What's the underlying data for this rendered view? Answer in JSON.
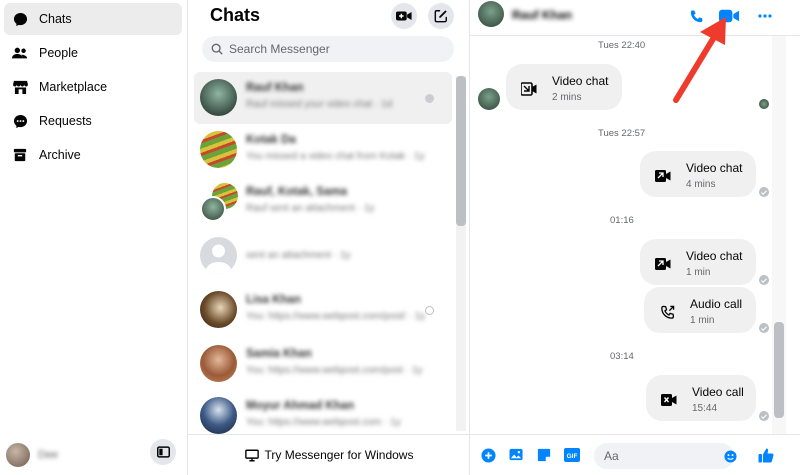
{
  "colors": {
    "accent": "#0084ff",
    "annotation_arrow": "#ee3b2b"
  },
  "nav": {
    "items": [
      {
        "label": "Chats",
        "icon": "chat-bubble-icon"
      },
      {
        "label": "People",
        "icon": "people-icon"
      },
      {
        "label": "Marketplace",
        "icon": "store-icon"
      },
      {
        "label": "Requests",
        "icon": "requests-icon"
      },
      {
        "label": "Archive",
        "icon": "archive-icon"
      }
    ]
  },
  "list": {
    "title": "Chats",
    "search_placeholder": "Search Messenger",
    "try_label": "Try Messenger for Windows",
    "conversations": [
      {
        "name": "Rauf Khan",
        "preview": "Rauf missed your video chat · 1d"
      },
      {
        "name": "Kotak Da",
        "preview": "You missed a video chat from Kotak · 1y"
      },
      {
        "name": "Rauf, Kotak, Sama",
        "preview": "Rauf sent an attachment · 1y"
      },
      {
        "name": "",
        "preview": "sent an attachment · 1y"
      },
      {
        "name": "Lisa Khan",
        "preview": "You: https://www.webpost.com/post/ · 1y"
      },
      {
        "name": "Samia Khan",
        "preview": "You: https://www.webpost.com/post · 1y"
      },
      {
        "name": "Moyur Ahmad Khan",
        "preview": "You: https://www.webpost.com · 1y"
      }
    ]
  },
  "me": {
    "name": "Dee"
  },
  "header": {
    "name": "Rauf Khan"
  },
  "thread": {
    "timestamps": [
      "Tues 22:40",
      "Tues 22:57",
      "01:16",
      "03:14"
    ],
    "calls": [
      {
        "title": "Video chat",
        "sub": "2 mins",
        "icon": "missed-video-icon"
      },
      {
        "title": "Video chat",
        "sub": "4 mins",
        "icon": "video-icon"
      },
      {
        "title": "Video chat",
        "sub": "1 min",
        "icon": "video-icon"
      },
      {
        "title": "Audio call",
        "sub": "1 min",
        "icon": "outgoing-call-icon"
      },
      {
        "title": "Video call",
        "sub": "15:44",
        "icon": "missed-video-call-icon"
      }
    ]
  },
  "composer": {
    "placeholder": "Aa"
  }
}
